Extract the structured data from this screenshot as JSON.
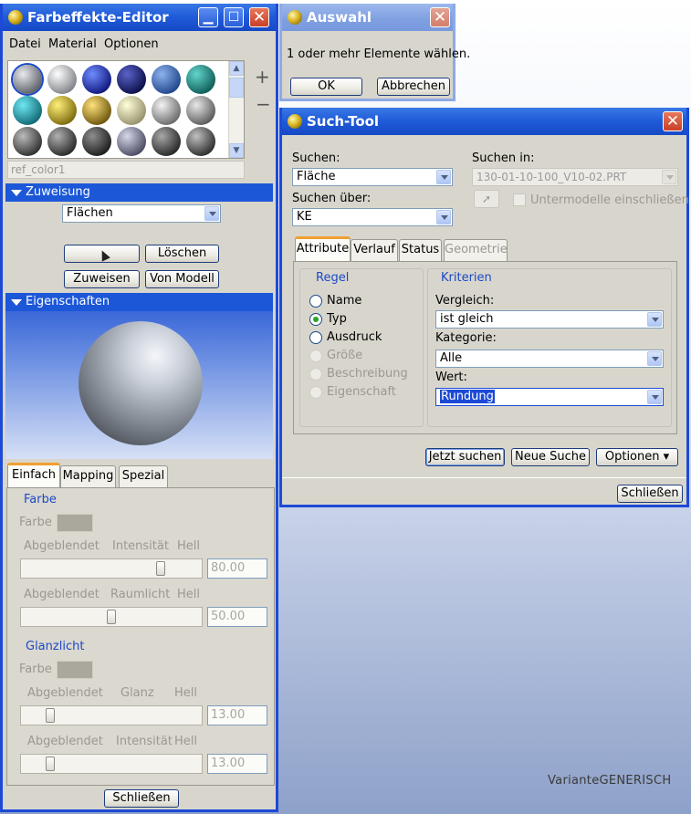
{
  "farbeffekte": {
    "title": "Farbeffekte-Editor",
    "menu": [
      "Datei",
      "Material",
      "Optionen"
    ],
    "add_label": "+",
    "remove_label": "−",
    "color_name": "ref_color1",
    "zuweisung_header": "Zuweisung",
    "zuweisung_select": "Flächen",
    "blank_button": "",
    "loeschen_label": "Löschen",
    "zuweisen_label": "Zuweisen",
    "von_modell_label": "Von Modell",
    "eigenschaften_header": "Eigenschaften",
    "tabs": [
      "Einfach",
      "Mapping",
      "Spezial"
    ],
    "farbe_title": "Farbe",
    "farbe_label": "Farbe",
    "row1": {
      "left": "Abgeblendet",
      "mid": "Intensität",
      "right": "Hell",
      "value": "80.00"
    },
    "row2": {
      "left": "Abgeblendet",
      "mid": "Raumlicht",
      "right": "Hell",
      "value": "50.00"
    },
    "glanzlicht_title": "Glanzlicht",
    "row3": {
      "left": "Abgeblendet",
      "mid": "Glanz",
      "right": "Hell",
      "value": "13.00"
    },
    "row4": {
      "left": "Abgeblendet",
      "mid": "Intensität",
      "right": "Hell",
      "value": "13.00"
    },
    "close_label": "Schließen",
    "sliders": {
      "row1": 0.8,
      "row2": 0.5,
      "row3": 0.13,
      "row4": 0.13
    }
  },
  "auswahl": {
    "title": "Auswahl",
    "message": "1 oder mehr Elemente wählen.",
    "ok_label": "OK",
    "cancel_label": "Abbrechen"
  },
  "such_tool": {
    "title": "Such-Tool",
    "suchen_label": "Suchen:",
    "suchen_value": "Fläche",
    "suchen_in_label": "Suchen in:",
    "suchen_in_value": "130-01-10-100_V10-02.PRT",
    "suchen_ueber_label": "Suchen über:",
    "suchen_ueber_value": "KE",
    "untermodelle_label": "Untermodelle einschließen",
    "tabs": [
      "Attribute",
      "Verlauf",
      "Status",
      "Geometrie"
    ],
    "regel_title": "Regel",
    "radios": [
      "Name",
      "Typ",
      "Ausdruck",
      "Größe",
      "Beschreibung",
      "Eigenschaft"
    ],
    "kriterien_title": "Kriterien",
    "vergleich_label": "Vergleich:",
    "vergleich_value": "ist gleich",
    "kategorie_label": "Kategorie:",
    "kategorie_value": "Alle",
    "wert_label": "Wert:",
    "wert_value": "Rundung",
    "jetzt_suchen_label": "Jetzt suchen",
    "neue_suche_label": "Neue Suche",
    "optionen_label": "Optionen ▾",
    "close_label": "Schließen"
  },
  "desktop_caption": "VarianteGENERISCH",
  "colors": {
    "title_active": "#1f5ad8",
    "section_blue": "#1c57d8",
    "dialog_bg": "#d8d6cc"
  }
}
